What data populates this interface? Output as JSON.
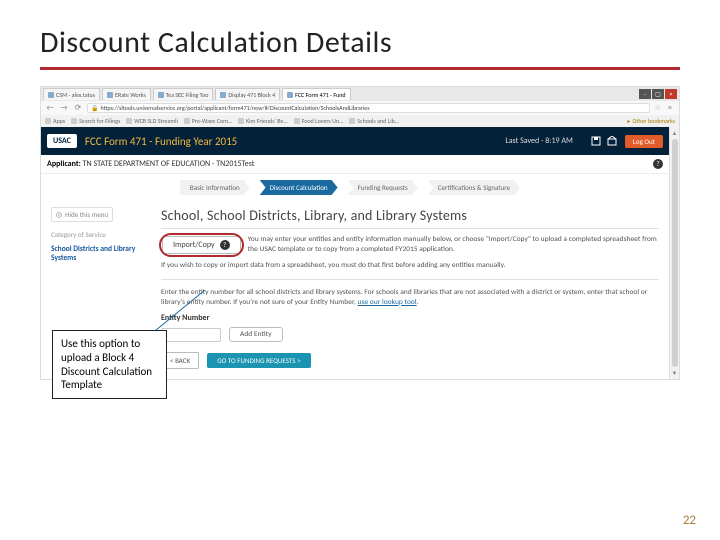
{
  "slide": {
    "title": "Discount Calculation Details",
    "page_number": "22"
  },
  "browser": {
    "tabs": [
      {
        "label": "CSM - alex.tatus"
      },
      {
        "label": "ERate Works"
      },
      {
        "label": "Tea SEC Filing Too"
      },
      {
        "label": "Display 471 Block 4"
      },
      {
        "label": "FCC Form 471 - Fund",
        "active": true
      }
    ],
    "url": "https://sltools.universalservice.org/portal/applicant/form471/new/#/DiscountCalculation/SchoolsAndLibraries",
    "bookmarks": [
      {
        "label": "Apps"
      },
      {
        "label": "Search for Filings"
      },
      {
        "label": "WCB SLD Streamli"
      },
      {
        "label": "Pre-Wave Com…"
      },
      {
        "label": "Kim Friends' Be…"
      },
      {
        "label": "Food Lovers Un…"
      },
      {
        "label": "Schools and Lib…"
      }
    ],
    "more_bookmarks": "Other bookmarks"
  },
  "usac": {
    "logo": "USAC",
    "form_title": "FCC Form 471 - Funding Year 2015",
    "last_saved": "Last Saved - 8:19 AM",
    "logout": "Log Out"
  },
  "applicant": {
    "label": "Applicant:",
    "name": "TN STATE DEPARTMENT OF EDUCATION - TN2015Test"
  },
  "progress": {
    "steps": [
      "Basic Information",
      "Discount Calculation",
      "Funding Requests",
      "Certifications & Signature"
    ],
    "active_index": 1
  },
  "sidebar": {
    "hide_label": "Hide this menu",
    "section_label": "Category of Service",
    "link": "School Districts and Library Systems"
  },
  "main": {
    "heading": "School, School Districts, Library, and Library Systems",
    "import_label": "Import/Copy",
    "paragraph1": "You may enter your entities and entity information manually below, or choose \"Import/Copy\" to upload a completed spreadsheet from the USAC template or to copy from a completed FY2015 application.",
    "paragraph2": "If you wish to copy or import data from a spreadsheet, you must do that first before adding any entities manually.",
    "entry_instructions": "Enter the entity number for all school districts and library systems. For schools and libraries that are not associated with a district or system, enter that school or library's entity number. If you're not sure of your Entity Number,",
    "lookup_text": "use our lookup tool",
    "entity_number_label": "Entity Number",
    "add_label": "Add Entity",
    "back_label": "< BACK",
    "forward_label": "GO TO FUNDING REQUESTS >"
  },
  "callout": {
    "text": "Use this option to upload a Block 4 Discount Calculation Template"
  }
}
